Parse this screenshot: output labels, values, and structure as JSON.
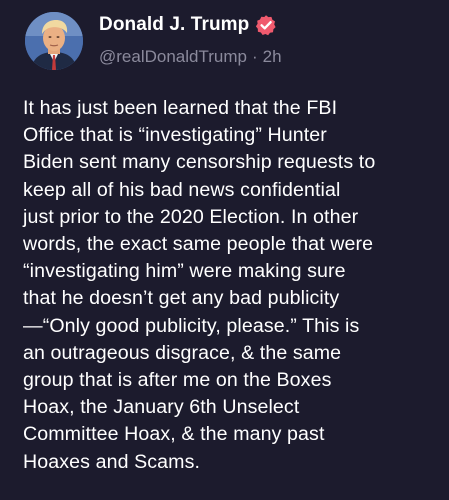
{
  "post": {
    "display_name": "Donald J. Trump",
    "handle": "@realDonaldTrump",
    "separator": "·",
    "time": "2h",
    "text": "It has just been learned that the FBI\nOffice that is “investigating” Hunter\nBiden sent many censorship requests to\nkeep all of his bad news confidential\njust prior to the 2020 Election. In other\nwords, the exact same people that were\n“investigating him” were making sure\nthat he doesn’t get any bad publicity\n—“Only good publicity, please.” This is\nan outrageous disgrace, & the same\ngroup that is after me on the Boxes\nHoax, the January 6th Unselect\nCommittee Hoax, & the many past\nHoaxes and Scams.",
    "verified_icon": "verified-badge-icon",
    "avatar_icon": "profile-avatar"
  },
  "colors": {
    "background": "#1c1b2d",
    "text": "#ffffff",
    "muted": "#8b8a9c",
    "verified": "#f05a6e"
  }
}
